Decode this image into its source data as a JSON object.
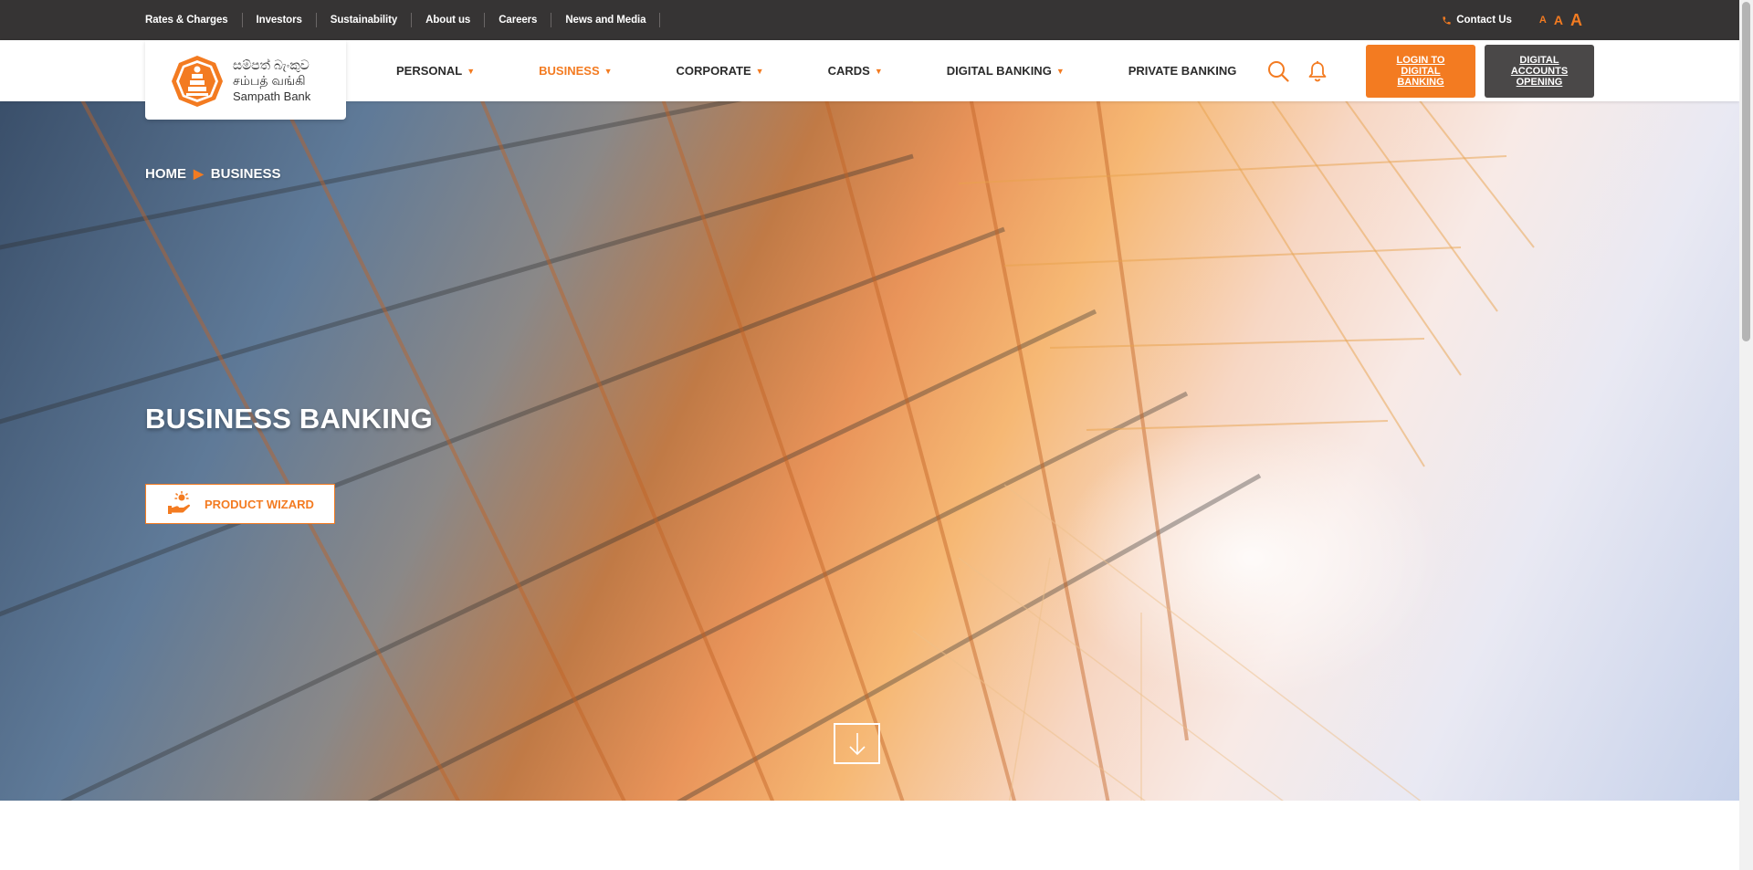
{
  "topbar": {
    "links": [
      "Rates & Charges",
      "Investors",
      "Sustainability",
      "About us",
      "Careers",
      "News and Media"
    ],
    "contact_label": "Contact Us",
    "font_sizes": [
      "A",
      "A",
      "A"
    ]
  },
  "logo": {
    "line1": "සම්පත් බැංකුව",
    "line2": "சம்பத் வங்கி",
    "line3": "Sampath Bank"
  },
  "nav": {
    "items": [
      {
        "label": "PERSONAL",
        "caret": "▼",
        "active": false
      },
      {
        "label": "BUSINESS",
        "caret": "▼",
        "active": true
      },
      {
        "label": "CORPORATE",
        "caret": "▼",
        "active": false
      },
      {
        "label": "CARDS",
        "caret": "▼",
        "active": false
      },
      {
        "label": "DIGITAL BANKING",
        "caret": "▼",
        "active": false
      },
      {
        "label": "PRIVATE BANKING",
        "caret": "",
        "active": false
      }
    ],
    "login_button": "LOGIN TO DIGITAL BANKING",
    "open_button": "DIGITAL ACCOUNTS OPENING"
  },
  "hero": {
    "breadcrumb": [
      "HOME",
      "BUSINESS"
    ],
    "breadcrumb_sep": "▶",
    "title": "BUSINESS BANKING",
    "wizard_label": "PRODUCT WIZARD"
  },
  "colors": {
    "accent": "#f37b21",
    "topbar": "#363434",
    "dark_button": "#4a4848"
  },
  "icons": [
    "phone-icon",
    "search-icon",
    "bell-icon",
    "product-wizard-icon",
    "arrow-down-icon"
  ]
}
